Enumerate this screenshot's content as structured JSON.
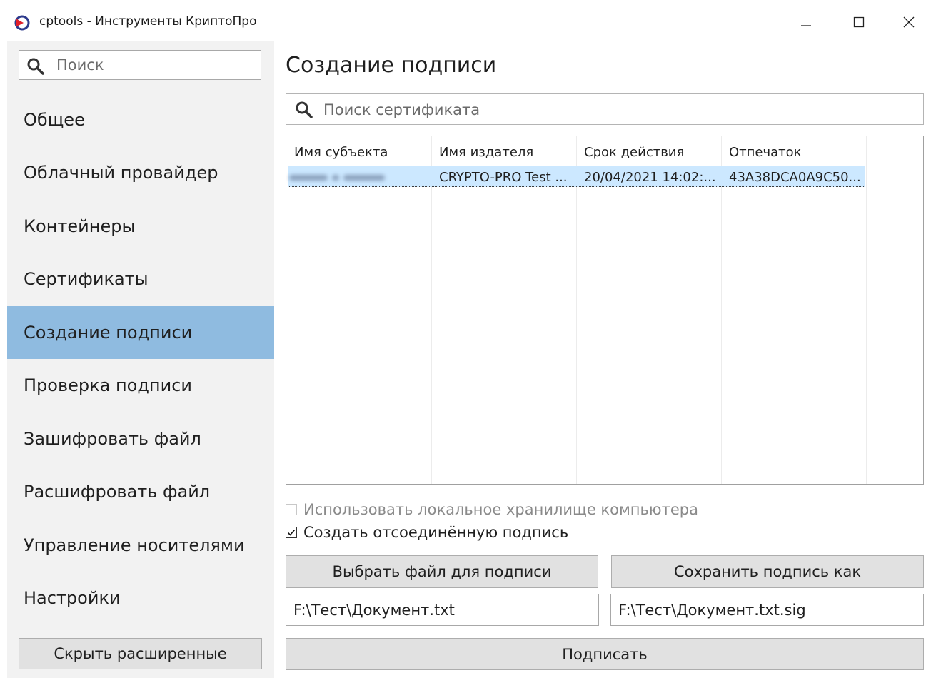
{
  "window": {
    "title": "cptools - Инструменты КриптоПро",
    "controls": [
      "minimize",
      "maximize",
      "close"
    ]
  },
  "sidebar": {
    "search_placeholder": "Поиск",
    "items": [
      {
        "label": "Общее"
      },
      {
        "label": "Облачный провайдер"
      },
      {
        "label": "Контейнеры"
      },
      {
        "label": "Сертификаты"
      },
      {
        "label": "Создание подписи",
        "active": true
      },
      {
        "label": "Проверка подписи"
      },
      {
        "label": "Зашифровать файл"
      },
      {
        "label": "Расшифровать файл"
      },
      {
        "label": "Управление носителями"
      },
      {
        "label": "Настройки"
      }
    ],
    "hide_button": "Скрыть расширенные"
  },
  "main": {
    "title": "Создание подписи",
    "cert_search_placeholder": "Поиск сертификата",
    "table": {
      "columns": [
        "Имя субъекта",
        "Имя издателя",
        "Срок действия",
        "Отпечаток"
      ],
      "rows": [
        {
          "subject": "",
          "subject_blurred": true,
          "issuer": "CRYPTO-PRO Test ...",
          "valid_until": "20/04/2021 14:02:...",
          "thumbprint": "43A38DCA0A9C50...",
          "selected": true
        }
      ]
    },
    "use_local_store": {
      "label": "Использовать локальное хранилище компьютера",
      "checked": false,
      "disabled": true
    },
    "detached_signature": {
      "label": "Создать отсоединённую подпись",
      "checked": true,
      "disabled": false
    },
    "choose_file_button": "Выбрать файл для подписи",
    "save_as_button": "Сохранить подпись как",
    "input_file": "F:\\Тест\\Документ.txt",
    "output_file": "F:\\Тест\\Документ.txt.sig",
    "sign_button": "Подписать"
  },
  "colors": {
    "active_nav": "#8fbbe0",
    "selected_row": "#cce8ff",
    "sidebar_bg": "#f2f2f2",
    "button_bg": "#e1e1e1"
  }
}
